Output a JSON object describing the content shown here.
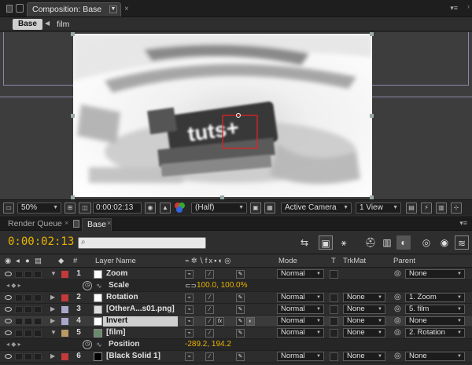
{
  "composition_panel": {
    "tab_title": "Composition: Base",
    "breadcrumbs": [
      "Base",
      "film"
    ],
    "preview_text": "tuts+",
    "controls": {
      "zoom": "50%",
      "timecode": "0:00:02:13",
      "resolution": "(Half)",
      "camera": "Active Camera",
      "view": "1 View"
    }
  },
  "timeline_panel": {
    "tabs": [
      "Render Queue",
      "Base"
    ],
    "timecode": "0:00:02:13",
    "search_placeholder": "",
    "columns": {
      "hash": "#",
      "layer_name": "Layer Name",
      "mode": "Mode",
      "t": "T",
      "trkmat": "TrkMat",
      "parent": "Parent"
    },
    "rows": [
      {
        "kind": "layer",
        "num": "1",
        "name": "Zoom",
        "label_color": "#c23a3a",
        "thumb_color": "#ffffff",
        "mode": "Normal",
        "trkmat": "",
        "parent": "None",
        "expanded": true
      },
      {
        "kind": "prop",
        "name": "Scale",
        "value": "100.0, 100.0%"
      },
      {
        "kind": "layer",
        "num": "2",
        "name": "Rotation",
        "label_color": "#c23a3a",
        "thumb_color": "#ffffff",
        "mode": "Normal",
        "trkmat": "None",
        "parent": "1. Zoom",
        "expanded": false
      },
      {
        "kind": "layer",
        "num": "3",
        "name": "[OtherA...s01.png]",
        "label_color": "#a8a8cc",
        "thumb_color": "#dddddd",
        "mode": "Normal",
        "trkmat": "None",
        "parent": "5. film",
        "expanded": false
      },
      {
        "kind": "layer",
        "num": "4",
        "name": "Invert",
        "label_color": "#a8a8cc",
        "thumb_color": "#ffffff",
        "mode": "Normal",
        "trkmat": "None",
        "parent": "None",
        "expanded": false,
        "selected": true
      },
      {
        "kind": "layer",
        "num": "5",
        "name": "[film]",
        "label_color": "#b89a66",
        "thumb_color": "#6a8b6a",
        "mode": "Normal",
        "trkmat": "None",
        "parent": "2. Rotation",
        "expanded": true
      },
      {
        "kind": "prop",
        "name": "Position",
        "value": "-289.2, 194.2"
      },
      {
        "kind": "layer",
        "num": "6",
        "name": "[Black Solid 1]",
        "label_color": "#c23a3a",
        "thumb_color": "#000000",
        "mode": "Normal",
        "trkmat": "None",
        "parent": "None",
        "expanded": false
      }
    ]
  }
}
